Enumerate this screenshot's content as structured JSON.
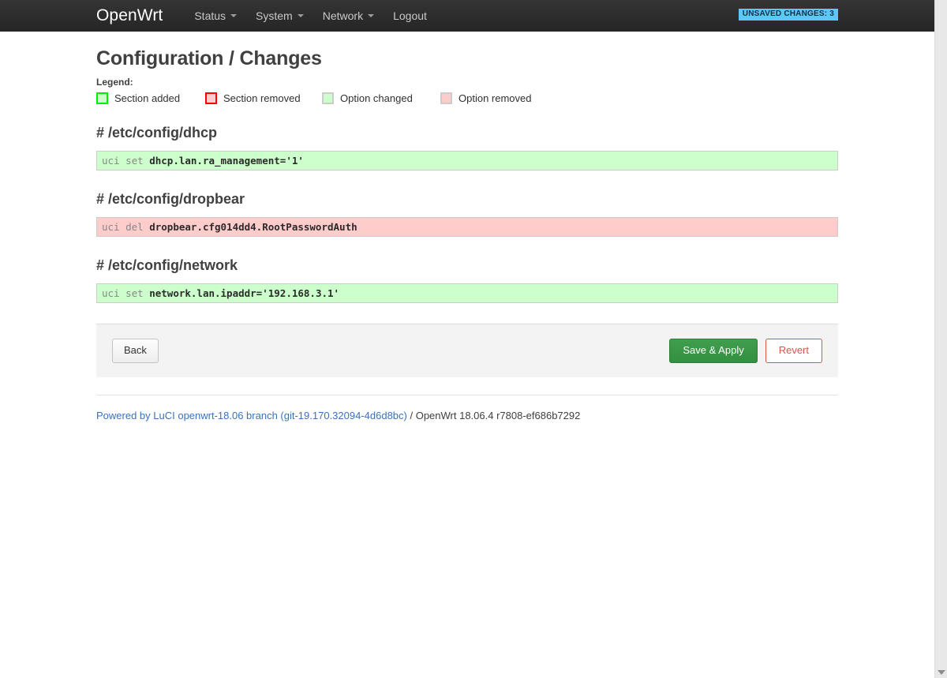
{
  "header": {
    "brand": "OpenWrt",
    "menu": [
      {
        "label": "Status",
        "has_caret": true
      },
      {
        "label": "System",
        "has_caret": true
      },
      {
        "label": "Network",
        "has_caret": true
      },
      {
        "label": "Logout",
        "has_caret": false
      }
    ],
    "unsaved_badge": "UNSAVED CHANGES: 3",
    "badge_color": "#5bc8f5"
  },
  "page": {
    "title": "Configuration / Changes",
    "legend_title": "Legend:",
    "legend": [
      {
        "label": "Section added",
        "swatch": "added",
        "fill": "#ccffcc",
        "border": "#00ee00"
      },
      {
        "label": "Section removed",
        "swatch": "removed",
        "fill": "#ffcccc",
        "border": "#ff0000"
      },
      {
        "label": "Option changed",
        "swatch": "changed",
        "fill": "#ccffcc",
        "border": "#cccccc"
      },
      {
        "label": "Option removed",
        "swatch": "optremoved",
        "fill": "#ffcccc",
        "border": "#cccccc"
      }
    ]
  },
  "sections": [
    {
      "title": "# /etc/config/dhcp",
      "rows": [
        {
          "kind": "set",
          "op": "uci set ",
          "target": "dhcp.lan.ra_management=",
          "value": "'1'"
        }
      ]
    },
    {
      "title": "# /etc/config/dropbear",
      "rows": [
        {
          "kind": "del",
          "op": "uci del ",
          "target": "dropbear.cfg014dd4.RootPasswordAuth",
          "value": ""
        }
      ]
    },
    {
      "title": "# /etc/config/network",
      "rows": [
        {
          "kind": "set",
          "op": "uci set ",
          "target": "network.lan.ipaddr=",
          "value": "'192.168.3.1'"
        }
      ]
    }
  ],
  "actions": {
    "back": "Back",
    "save_apply": "Save & Apply",
    "revert": "Revert"
  },
  "footer": {
    "link_text": "Powered by LuCI openwrt-18.06 branch (git-19.170.32094-4d6d8bc)",
    "suffix": " / OpenWrt 18.06.4 r7808-ef686b7292"
  }
}
